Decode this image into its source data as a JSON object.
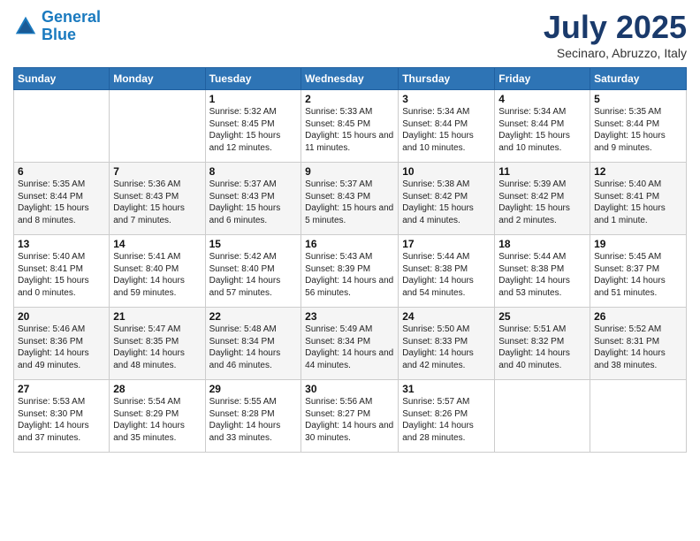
{
  "logo": {
    "line1": "General",
    "line2": "Blue"
  },
  "title": "July 2025",
  "subtitle": "Secinaro, Abruzzo, Italy",
  "days_of_week": [
    "Sunday",
    "Monday",
    "Tuesday",
    "Wednesday",
    "Thursday",
    "Friday",
    "Saturday"
  ],
  "weeks": [
    [
      {
        "day": "",
        "info": ""
      },
      {
        "day": "",
        "info": ""
      },
      {
        "day": "1",
        "info": "Sunrise: 5:32 AM\nSunset: 8:45 PM\nDaylight: 15 hours and 12 minutes."
      },
      {
        "day": "2",
        "info": "Sunrise: 5:33 AM\nSunset: 8:45 PM\nDaylight: 15 hours and 11 minutes."
      },
      {
        "day": "3",
        "info": "Sunrise: 5:34 AM\nSunset: 8:44 PM\nDaylight: 15 hours and 10 minutes."
      },
      {
        "day": "4",
        "info": "Sunrise: 5:34 AM\nSunset: 8:44 PM\nDaylight: 15 hours and 10 minutes."
      },
      {
        "day": "5",
        "info": "Sunrise: 5:35 AM\nSunset: 8:44 PM\nDaylight: 15 hours and 9 minutes."
      }
    ],
    [
      {
        "day": "6",
        "info": "Sunrise: 5:35 AM\nSunset: 8:44 PM\nDaylight: 15 hours and 8 minutes."
      },
      {
        "day": "7",
        "info": "Sunrise: 5:36 AM\nSunset: 8:43 PM\nDaylight: 15 hours and 7 minutes."
      },
      {
        "day": "8",
        "info": "Sunrise: 5:37 AM\nSunset: 8:43 PM\nDaylight: 15 hours and 6 minutes."
      },
      {
        "day": "9",
        "info": "Sunrise: 5:37 AM\nSunset: 8:43 PM\nDaylight: 15 hours and 5 minutes."
      },
      {
        "day": "10",
        "info": "Sunrise: 5:38 AM\nSunset: 8:42 PM\nDaylight: 15 hours and 4 minutes."
      },
      {
        "day": "11",
        "info": "Sunrise: 5:39 AM\nSunset: 8:42 PM\nDaylight: 15 hours and 2 minutes."
      },
      {
        "day": "12",
        "info": "Sunrise: 5:40 AM\nSunset: 8:41 PM\nDaylight: 15 hours and 1 minute."
      }
    ],
    [
      {
        "day": "13",
        "info": "Sunrise: 5:40 AM\nSunset: 8:41 PM\nDaylight: 15 hours and 0 minutes."
      },
      {
        "day": "14",
        "info": "Sunrise: 5:41 AM\nSunset: 8:40 PM\nDaylight: 14 hours and 59 minutes."
      },
      {
        "day": "15",
        "info": "Sunrise: 5:42 AM\nSunset: 8:40 PM\nDaylight: 14 hours and 57 minutes."
      },
      {
        "day": "16",
        "info": "Sunrise: 5:43 AM\nSunset: 8:39 PM\nDaylight: 14 hours and 56 minutes."
      },
      {
        "day": "17",
        "info": "Sunrise: 5:44 AM\nSunset: 8:38 PM\nDaylight: 14 hours and 54 minutes."
      },
      {
        "day": "18",
        "info": "Sunrise: 5:44 AM\nSunset: 8:38 PM\nDaylight: 14 hours and 53 minutes."
      },
      {
        "day": "19",
        "info": "Sunrise: 5:45 AM\nSunset: 8:37 PM\nDaylight: 14 hours and 51 minutes."
      }
    ],
    [
      {
        "day": "20",
        "info": "Sunrise: 5:46 AM\nSunset: 8:36 PM\nDaylight: 14 hours and 49 minutes."
      },
      {
        "day": "21",
        "info": "Sunrise: 5:47 AM\nSunset: 8:35 PM\nDaylight: 14 hours and 48 minutes."
      },
      {
        "day": "22",
        "info": "Sunrise: 5:48 AM\nSunset: 8:34 PM\nDaylight: 14 hours and 46 minutes."
      },
      {
        "day": "23",
        "info": "Sunrise: 5:49 AM\nSunset: 8:34 PM\nDaylight: 14 hours and 44 minutes."
      },
      {
        "day": "24",
        "info": "Sunrise: 5:50 AM\nSunset: 8:33 PM\nDaylight: 14 hours and 42 minutes."
      },
      {
        "day": "25",
        "info": "Sunrise: 5:51 AM\nSunset: 8:32 PM\nDaylight: 14 hours and 40 minutes."
      },
      {
        "day": "26",
        "info": "Sunrise: 5:52 AM\nSunset: 8:31 PM\nDaylight: 14 hours and 38 minutes."
      }
    ],
    [
      {
        "day": "27",
        "info": "Sunrise: 5:53 AM\nSunset: 8:30 PM\nDaylight: 14 hours and 37 minutes."
      },
      {
        "day": "28",
        "info": "Sunrise: 5:54 AM\nSunset: 8:29 PM\nDaylight: 14 hours and 35 minutes."
      },
      {
        "day": "29",
        "info": "Sunrise: 5:55 AM\nSunset: 8:28 PM\nDaylight: 14 hours and 33 minutes."
      },
      {
        "day": "30",
        "info": "Sunrise: 5:56 AM\nSunset: 8:27 PM\nDaylight: 14 hours and 30 minutes."
      },
      {
        "day": "31",
        "info": "Sunrise: 5:57 AM\nSunset: 8:26 PM\nDaylight: 14 hours and 28 minutes."
      },
      {
        "day": "",
        "info": ""
      },
      {
        "day": "",
        "info": ""
      }
    ]
  ]
}
